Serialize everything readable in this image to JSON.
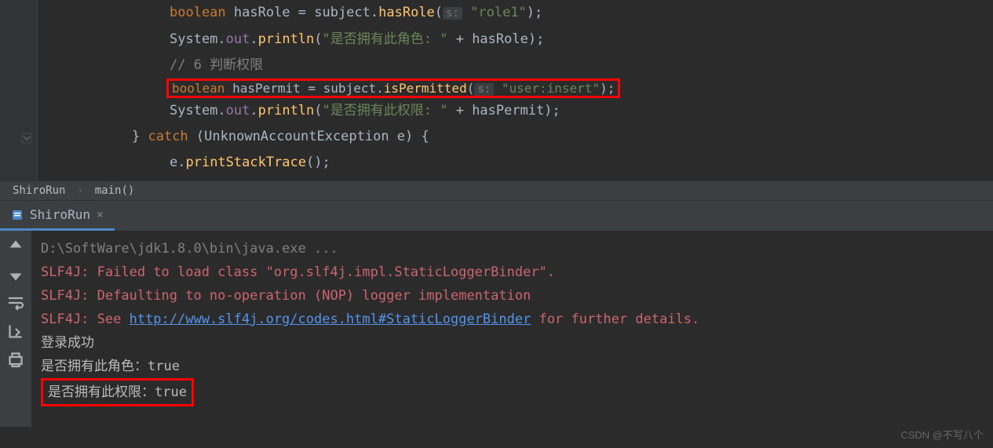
{
  "editor": {
    "lines": {
      "l1_kw": "boolean",
      "l1_var": " hasRole = subject.",
      "l1_method": "hasRole",
      "l1_p1": "(",
      "l1_hint": "s:",
      "l1_str": " \"role1\"",
      "l1_p2": ");",
      "l2_cls": "System.",
      "l2_field": "out",
      "l2_dot": ".",
      "l2_method": "println",
      "l2_p1": "(",
      "l2_str": "\"是否拥有此角色: \"",
      "l2_plus": " + hasRole);",
      "l3_comment": "// 6 判断权限",
      "l4_kw": "boolean",
      "l4_var": " hasPermit = subject.",
      "l4_method": "isPermitted",
      "l4_p1": "(",
      "l4_hint": "s:",
      "l4_str": " \"user:insert\"",
      "l4_p2": ");",
      "l5_cls": "System.",
      "l5_field": "out",
      "l5_dot": ".",
      "l5_method": "println",
      "l5_p1": "(",
      "l5_str": "\"是否拥有此权限: \"",
      "l5_plus": " + hasPermit);",
      "l6_brace": "} ",
      "l6_kw": "catch",
      "l6_p1": " (",
      "l6_cls": "UnknownAccountException",
      "l6_var": " e) {",
      "l7_var": "e.",
      "l7_method": "printStackTrace",
      "l7_p": "();"
    }
  },
  "breadcrumb": {
    "item1": "ShiroRun",
    "item2": "main()"
  },
  "tab": {
    "name": "ShiroRun"
  },
  "console": {
    "cmd": "D:\\SoftWare\\jdk1.8.0\\bin\\java.exe ...",
    "err1": "SLF4J: Failed to load class \"org.slf4j.impl.StaticLoggerBinder\".",
    "err2": "SLF4J: Defaulting to no-operation (NOP) logger implementation",
    "err3_pre": "SLF4J: See ",
    "err3_link": "http://www.slf4j.org/codes.html#StaticLoggerBinder",
    "err3_post": " for further details.",
    "out1": "登录成功",
    "out2": "是否拥有此角色：true",
    "out3": "是否拥有此权限：true"
  },
  "watermark": "CSDN @不写八个"
}
